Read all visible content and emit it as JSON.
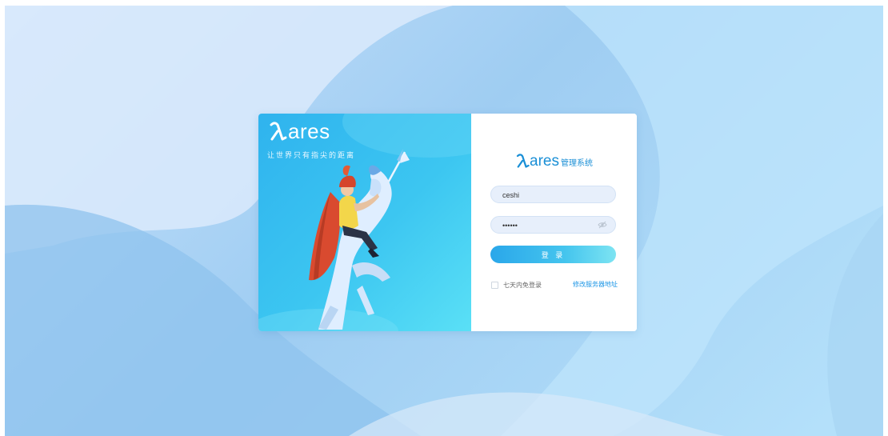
{
  "promo": {
    "logo_text": "ares",
    "slogan": "让世界只有指尖的距离"
  },
  "login": {
    "brand_name": "ares",
    "brand_suffix": "管理系统",
    "username_value": "ceshi",
    "password_value": "••••••",
    "login_button": "登 录",
    "remember_label": "七天内免登录",
    "server_link": "修改服务器地址"
  },
  "colors": {
    "accent": "#1a8fd6",
    "link": "#1f97e6",
    "button_start": "#2aa7ea",
    "button_end": "#7de4f2"
  },
  "icons": {
    "logo": "lambda-logo-icon",
    "password_toggle": "eye-icon"
  }
}
